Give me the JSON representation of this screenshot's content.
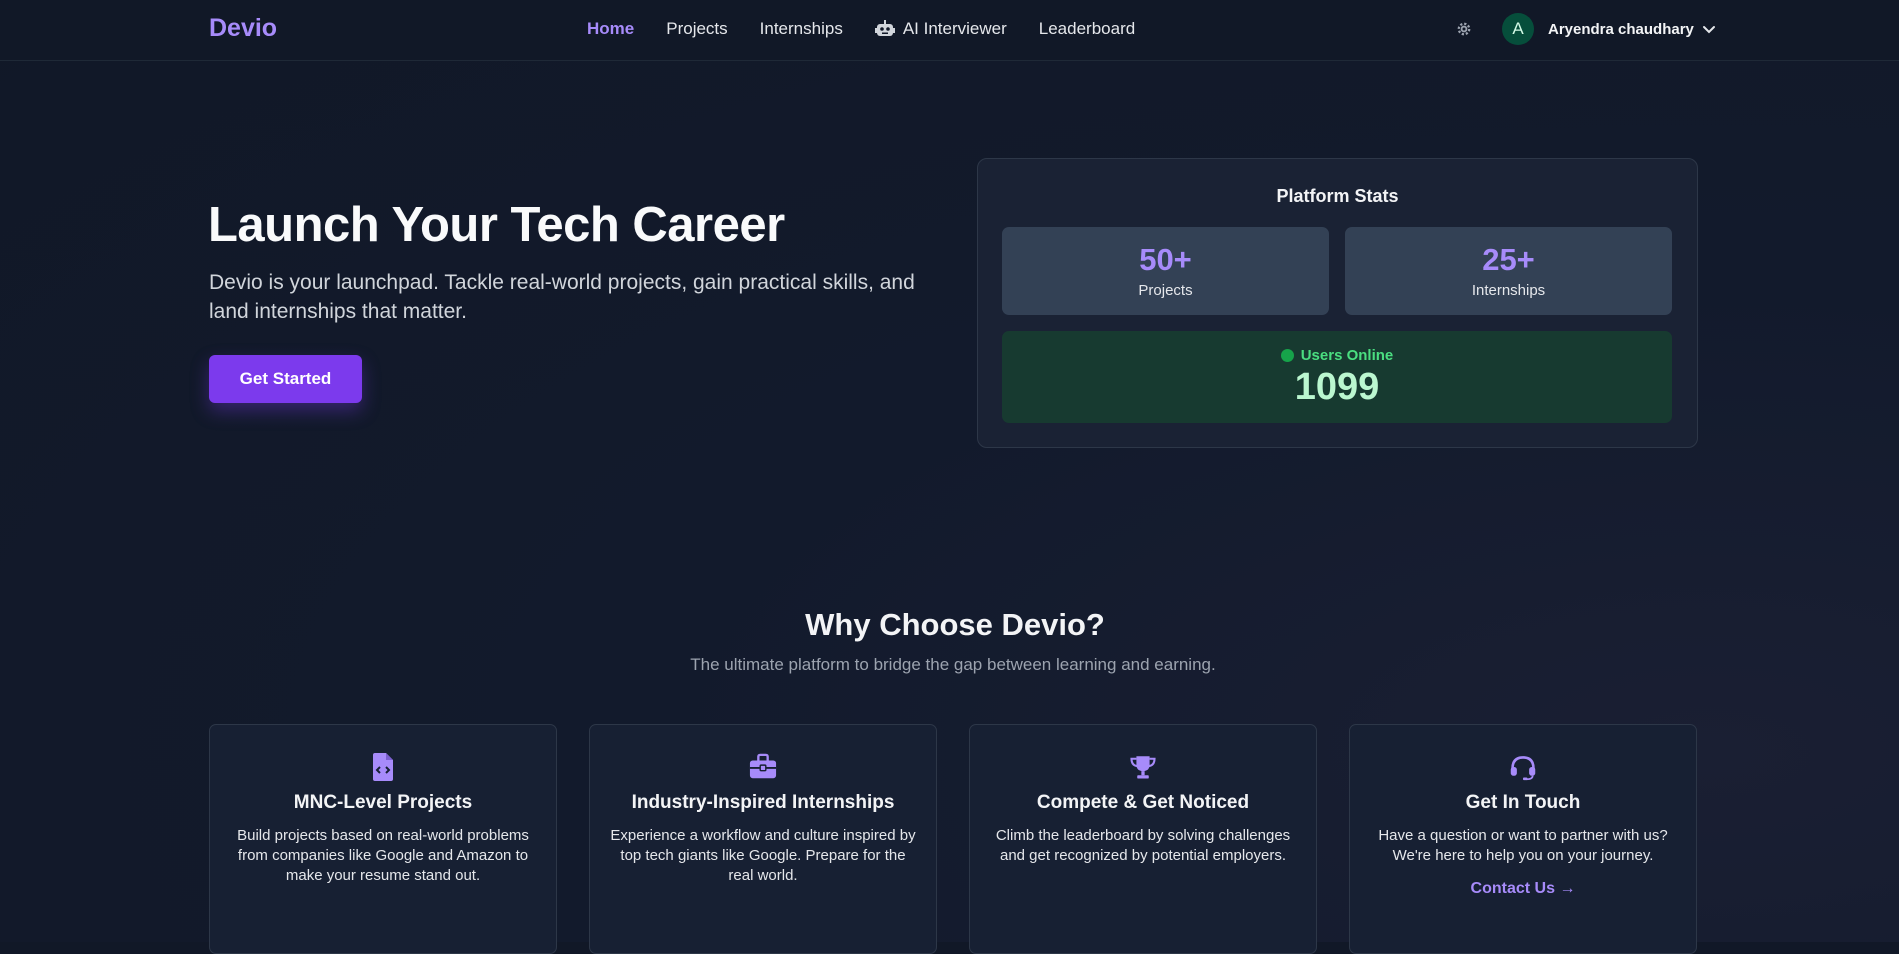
{
  "nav": {
    "logo": "Devio",
    "links": [
      "Home",
      "Projects",
      "Internships",
      "AI Interviewer",
      "Leaderboard"
    ],
    "active_link": "Home",
    "user": {
      "initial": "A",
      "name": "Aryendra chaudhary"
    },
    "icons": [
      "robot-icon",
      "gear-icon",
      "chevron-down-icon"
    ]
  },
  "hero": {
    "title": "Launch Your Tech Career",
    "description": "Devio is your launchpad. Tackle real-world projects, gain practical skills, and land internships that matter.",
    "cta": "Get Started"
  },
  "stats": {
    "title": "Platform Stats",
    "projects": {
      "value": "50+",
      "label": "Projects"
    },
    "internships": {
      "value": "25+",
      "label": "Internships"
    },
    "online": {
      "label": "Users Online",
      "value": "1099"
    }
  },
  "why": {
    "title": "Why Choose Devio?",
    "subtitle": "The ultimate platform to bridge the gap between learning and earning.",
    "features": [
      {
        "icon": "file-code-icon",
        "title": "MNC-Level Projects",
        "description": "Build projects based on real-world problems from companies like Google and Amazon to make your resume stand out."
      },
      {
        "icon": "briefcase-icon",
        "title": "Industry-Inspired Internships",
        "description": "Experience a workflow and culture inspired by top tech giants like Google. Prepare for the real world."
      },
      {
        "icon": "trophy-icon",
        "title": "Compete & Get Noticed",
        "description": "Climb the leaderboard by solving challenges and get recognized by potential employers."
      },
      {
        "icon": "headset-icon",
        "title": "Get In Touch",
        "description": "Have a question or want to partner with us? We're here to help you on your journey.",
        "link": "Contact Us →"
      }
    ]
  },
  "colors": {
    "accent": "#a78bfa",
    "button": "#7c3aed",
    "online": "#4ade80",
    "background": "#111827"
  }
}
